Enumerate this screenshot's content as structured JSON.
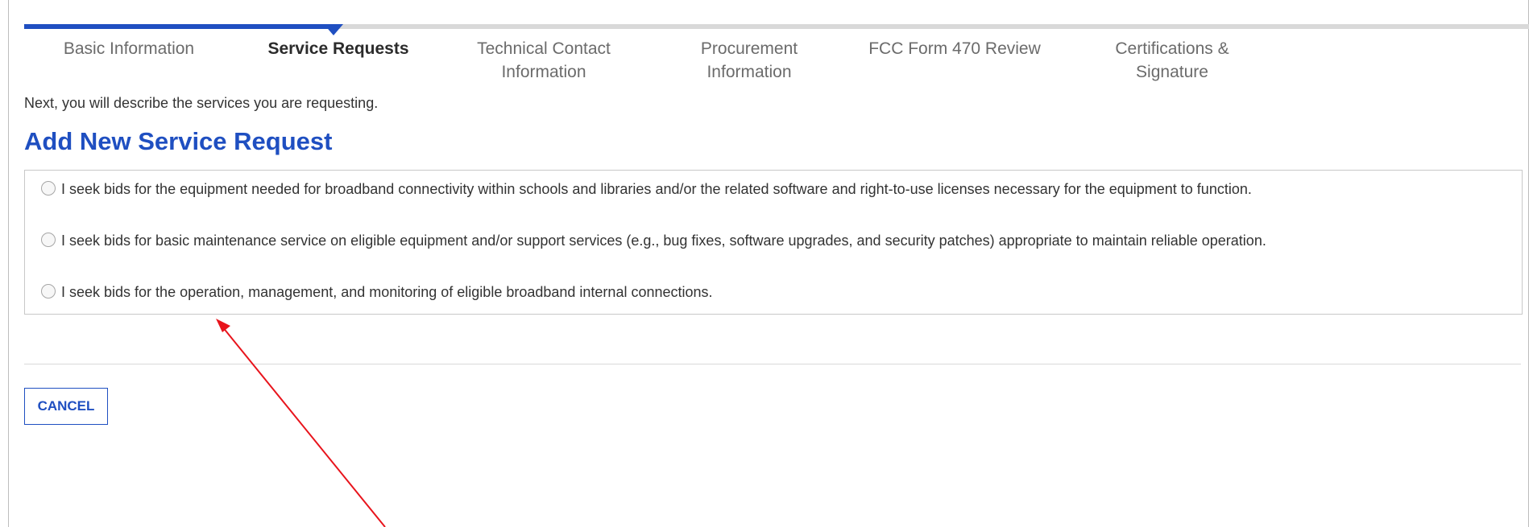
{
  "steps": [
    {
      "label": "Basic Information",
      "active": false
    },
    {
      "label": "Service Requests",
      "active": true
    },
    {
      "label": "Technical Contact\nInformation",
      "active": false
    },
    {
      "label": "Procurement\nInformation",
      "active": false
    },
    {
      "label": "FCC Form 470 Review",
      "active": false
    },
    {
      "label": "Certifications &\nSignature",
      "active": false
    }
  ],
  "intro_text": "Next, you will describe the services you are requesting.",
  "heading": "Add New Service Request",
  "options": [
    {
      "text": "I seek bids for the equipment needed for broadband connectivity within schools and libraries and/or the related software and right-to-use licenses necessary for the equipment to function.",
      "selected": false
    },
    {
      "text": "I seek bids for basic maintenance service on eligible equipment and/or support services (e.g., bug fixes, software upgrades, and security patches) appropriate to maintain reliable operation.",
      "selected": false
    },
    {
      "text": "I seek bids for the operation, management, and monitoring of eligible broadband internal connections.",
      "selected": false
    }
  ],
  "cancel_label": "CANCEL",
  "colors": {
    "accent": "#1f4fc1",
    "annotation_arrow": "#e8141c"
  }
}
